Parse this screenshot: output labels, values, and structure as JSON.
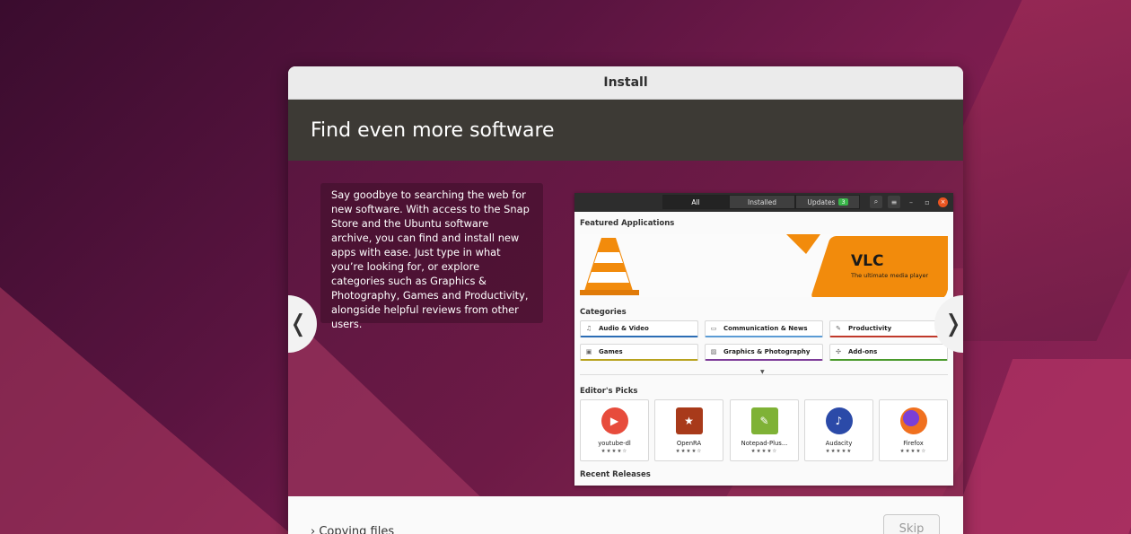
{
  "window": {
    "title": "Install"
  },
  "banner": {
    "heading": "Find even more software"
  },
  "slide": {
    "description": "Say goodbye to searching the web for new software. With access to the Snap Store and the Ubuntu software archive, you can find and install new apps with ease. Just type in what you’re looking for, or explore categories such as Graphics & Photography, Games and Productivity, alongside helpful reviews from other users.",
    "prev_glyph": "❬",
    "next_glyph": "❭"
  },
  "screenshot": {
    "tabs": {
      "all": "All",
      "installed": "Installed",
      "updates": "Updates",
      "updates_count": "3"
    },
    "featured_title": "Featured Applications",
    "featured_app": {
      "name": "VLC",
      "tagline": "The ultimate media player"
    },
    "categories_title": "Categories",
    "categories": [
      {
        "label": "Audio & Video",
        "icon": "music-note-icon",
        "color": "#2c6db5"
      },
      {
        "label": "Communication & News",
        "icon": "chat-icon",
        "color": "#5b9bd5"
      },
      {
        "label": "Productivity",
        "icon": "edit-icon",
        "color": "#c0392b"
      },
      {
        "label": "Games",
        "icon": "game-icon",
        "color": "#b8a21e"
      },
      {
        "label": "Graphics & Photography",
        "icon": "image-icon",
        "color": "#7d3c98"
      },
      {
        "label": "Add-ons",
        "icon": "puzzle-icon",
        "color": "#4a9a2c"
      }
    ],
    "editors_picks_title": "Editor's Picks",
    "picks": [
      {
        "name": "youtube-dl",
        "stars": "★★★★☆",
        "icon_color": "#e74c3c"
      },
      {
        "name": "OpenRA",
        "stars": "★★★★☆",
        "icon_color": "#a83a1a"
      },
      {
        "name": "Notepad-Plus...",
        "stars": "★★★★☆",
        "icon_color": "#7fb236"
      },
      {
        "name": "Audacity",
        "stars": "★★★★★",
        "icon_color": "#2b4aa8"
      },
      {
        "name": "Firefox",
        "stars": "★★★★☆",
        "icon_color": "#f0701f"
      }
    ],
    "recent_title": "Recent Releases"
  },
  "footer": {
    "status": "› Copying files",
    "skip_label": "Skip"
  },
  "colors": {
    "accent": "#e95420",
    "banner": "#3d3a35"
  }
}
